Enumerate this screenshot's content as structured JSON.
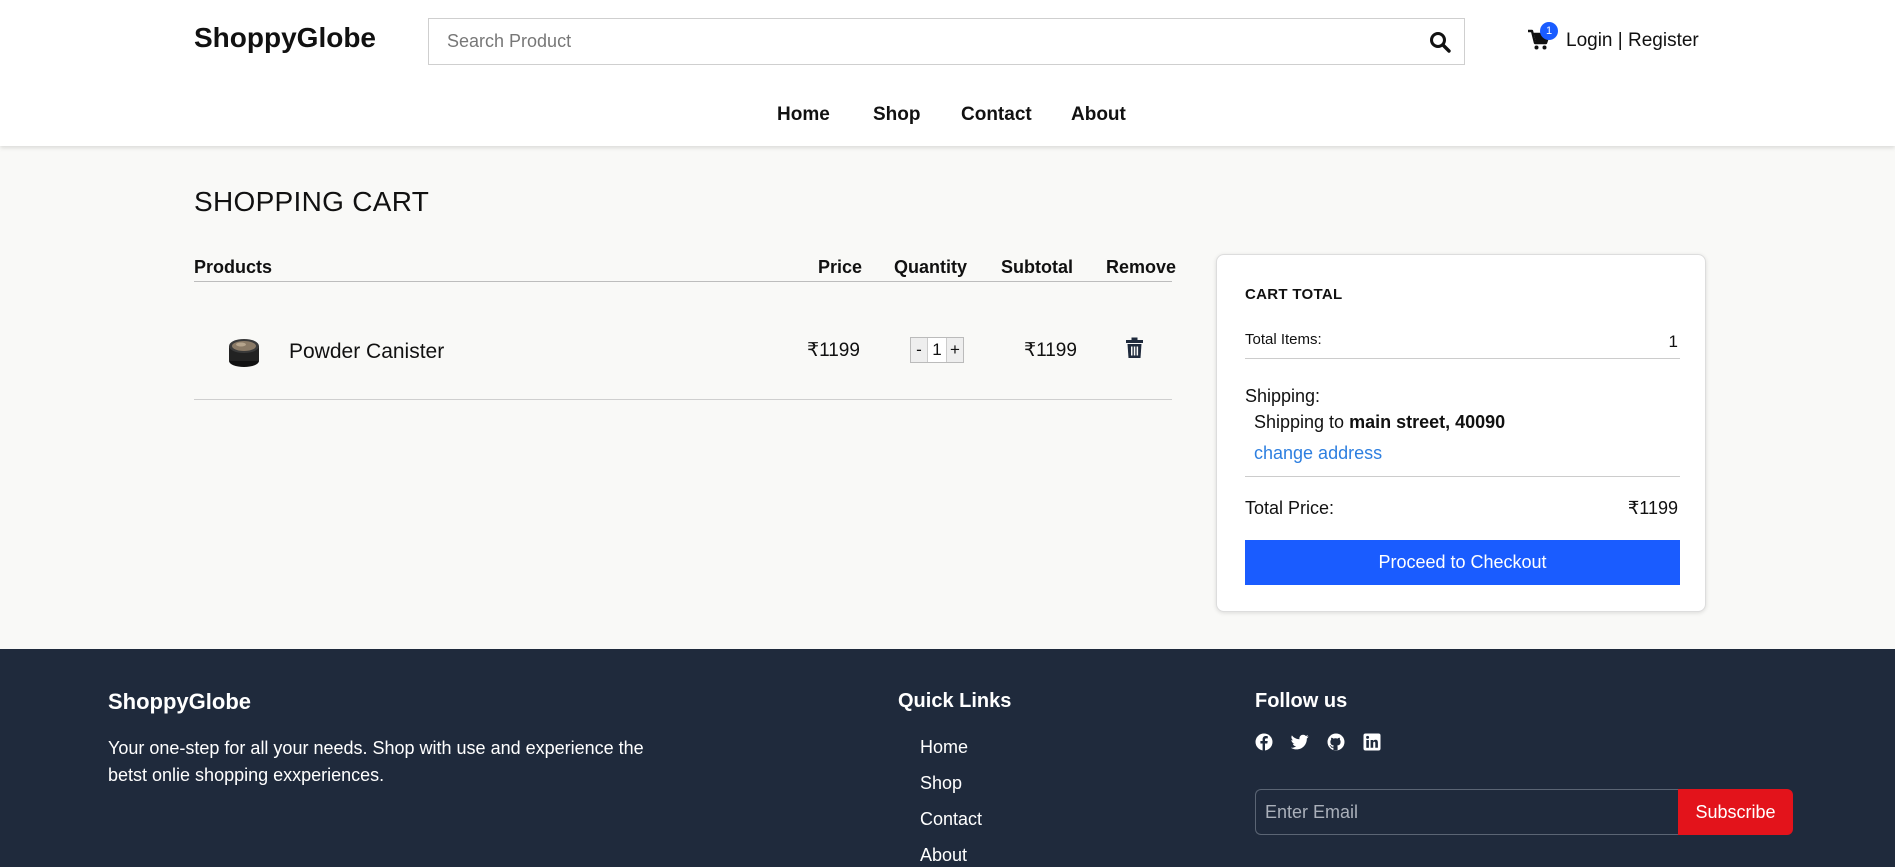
{
  "header": {
    "logo": "ShoppyGlobe",
    "search_placeholder": "Search Product",
    "cart_count": "1",
    "login": "Login",
    "separator": "|",
    "register": "Register",
    "nav": [
      "Home",
      "Shop",
      "Contact",
      "About"
    ]
  },
  "cart": {
    "title": "SHOPPING CART",
    "columns": [
      "Products",
      "Price",
      "Quantity",
      "Subtotal",
      "Remove"
    ],
    "items": [
      {
        "name": "Powder Canister",
        "price": "₹1199",
        "quantity": "1",
        "subtotal": "₹1199"
      }
    ],
    "qty_minus": "-",
    "qty_plus": "+"
  },
  "summary": {
    "title": "CART TOTAL",
    "total_items_label": "Total Items:",
    "total_items": "1",
    "shipping_label": "Shipping:",
    "shipping_prefix": "Shipping to",
    "shipping_address": "main street, 40090",
    "change_address": "change address",
    "total_price_label": "Total Price:",
    "total_price": "₹1199",
    "checkout": "Proceed to Checkout"
  },
  "footer": {
    "brand": "ShoppyGlobe",
    "description": "Your one-step for all your needs. Shop with use and experience the betst onlie shopping exxperiences.",
    "quick_links_title": "Quick Links",
    "quick_links": [
      "Home",
      "Shop",
      "Contact",
      "About"
    ],
    "follow_title": "Follow us",
    "social": [
      "facebook-icon",
      "twitter-icon",
      "github-icon",
      "linkedin-icon"
    ],
    "email_placeholder": "Enter Email",
    "subscribe": "Subscribe"
  },
  "colors": {
    "primary": "#1a5cff",
    "footer_bg": "#1f2a3c",
    "subscribe": "#e3131b",
    "link": "#2d7fe0",
    "page_bg": "#f9f9f7"
  }
}
